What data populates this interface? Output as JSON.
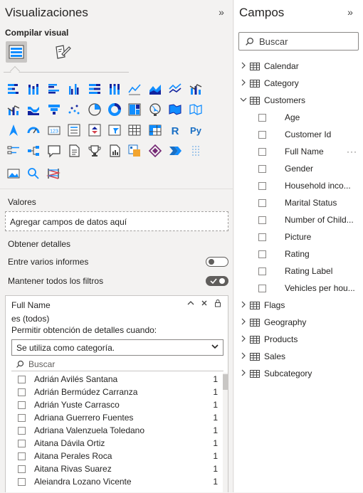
{
  "visualizations": {
    "title": "Visualizaciones",
    "build_label": "Compilar visual",
    "more_visuals": "···",
    "values_label": "Valores",
    "values_drop": "Agregar campos de datos aquí",
    "drillthrough_label": "Obtener detalles",
    "cross_report_label": "Entre varios informes",
    "cross_report_on": false,
    "keep_filters_label": "Mantener todos los filtros",
    "keep_filters_on": true,
    "filter_card": {
      "title": "Full Name",
      "condition": "es (todos)",
      "allow_label": "Permitir obtención de detalles cuando:",
      "select_value": "Se utiliza como categoría.",
      "search_placeholder": "Buscar",
      "items": [
        {
          "name": "Adrián Avilés Santana",
          "count": "1"
        },
        {
          "name": "Adrián Bermúdez Carranza",
          "count": "1"
        },
        {
          "name": "Adrián Yuste Carrasco",
          "count": "1"
        },
        {
          "name": "Adriana Guerrero Fuentes",
          "count": "1"
        },
        {
          "name": "Adriana Valenzuela Toledano",
          "count": "1"
        },
        {
          "name": "Aitana Dávila Ortiz",
          "count": "1"
        },
        {
          "name": "Aitana Perales Roca",
          "count": "1"
        },
        {
          "name": "Aitana Rivas Suarez",
          "count": "1"
        },
        {
          "name": "Aleiandra Lozano Vicente",
          "count": "1"
        }
      ]
    }
  },
  "fields": {
    "title": "Campos",
    "search_placeholder": "Buscar",
    "tables_before": [
      {
        "name": "Calendar"
      },
      {
        "name": "Category"
      }
    ],
    "expanded_table": {
      "name": "Customers",
      "columns": [
        "Age",
        "Customer Id",
        "Full Name",
        "Gender",
        "Household inco...",
        "Marital Status",
        "Number of Child...",
        "Picture",
        "Rating",
        "Rating Label",
        "Vehicles per hou..."
      ]
    },
    "tables_after": [
      {
        "name": "Flags"
      },
      {
        "name": "Geography"
      },
      {
        "name": "Products"
      },
      {
        "name": "Sales"
      },
      {
        "name": "Subcategory"
      }
    ]
  },
  "colors": {
    "accent_blue": "#1a6fc4",
    "accent_teal": "#118dff",
    "pane_bg": "#f3f2f1"
  }
}
